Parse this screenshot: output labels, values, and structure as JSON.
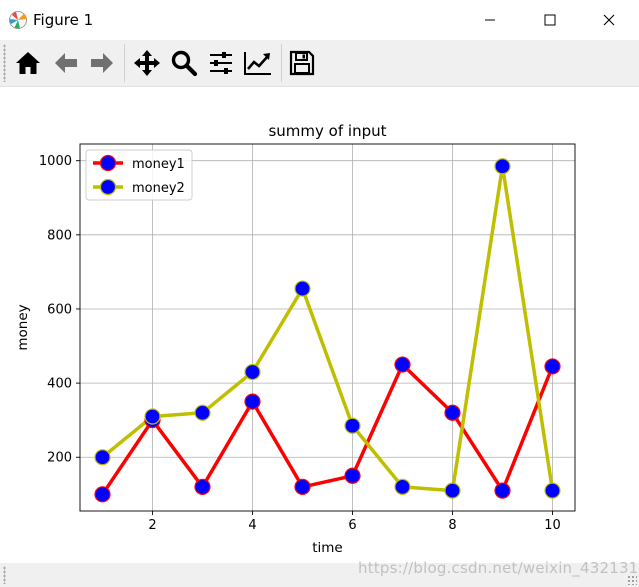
{
  "window": {
    "title": "Figure 1",
    "icon": "matplotlib-icon",
    "controls": [
      "minimize-icon",
      "maximize-icon",
      "close-icon"
    ]
  },
  "toolbar": {
    "tools": [
      "home-icon",
      "back-arrow-icon",
      "forward-arrow-icon",
      "pan-icon",
      "zoom-icon",
      "subplots-icon",
      "edit-axis-icon",
      "save-icon"
    ]
  },
  "watermark": "https://blog.csdn.net/weixin_43213117",
  "chart_data": {
    "type": "line",
    "title": "summy of input",
    "xlabel": "time",
    "ylabel": "money",
    "xlim": [
      0.55,
      10.45
    ],
    "ylim": [
      55,
      1045
    ],
    "xticks": [
      2,
      4,
      6,
      8,
      10
    ],
    "yticks": [
      200,
      400,
      600,
      800,
      1000
    ],
    "grid": true,
    "legend_position": "upper left",
    "x": [
      1,
      2,
      3,
      4,
      5,
      6,
      7,
      8,
      9,
      10
    ],
    "series": [
      {
        "name": "money1",
        "color": "#ff0000",
        "marker_color": "#0000ff",
        "values": [
          100,
          300,
          120,
          350,
          120,
          150,
          450,
          320,
          110,
          445
        ]
      },
      {
        "name": "money2",
        "color": "#bfbf00",
        "marker_color": "#0000ff",
        "values": [
          200,
          310,
          320,
          430,
          655,
          285,
          120,
          110,
          985,
          110
        ]
      }
    ]
  }
}
